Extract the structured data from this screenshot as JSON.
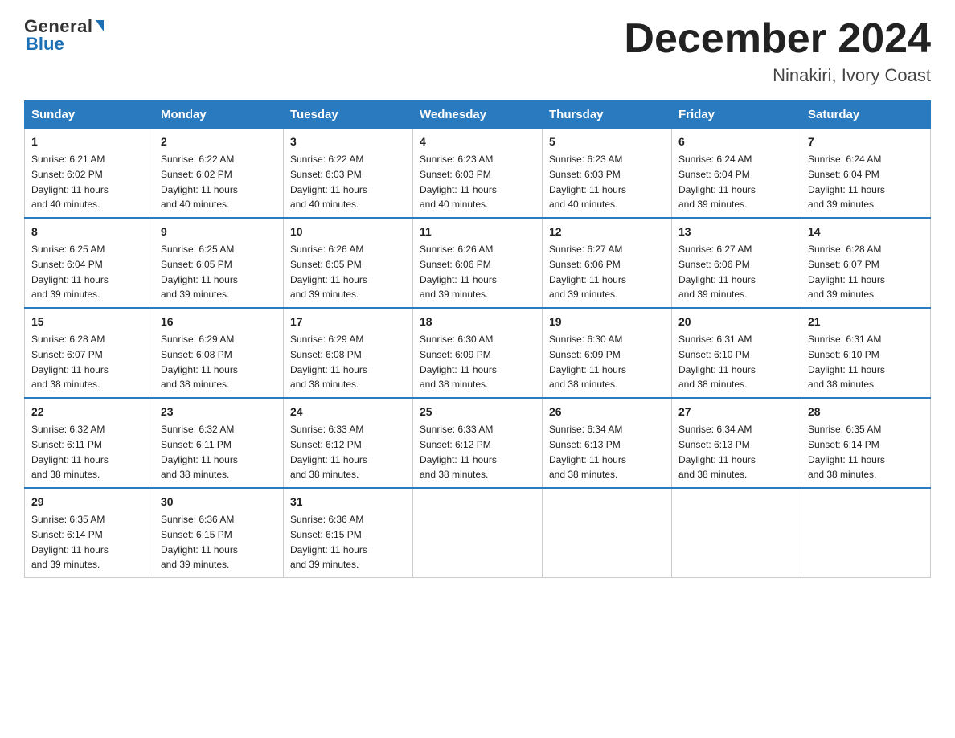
{
  "header": {
    "logo_general": "General",
    "logo_blue": "Blue",
    "month_title": "December 2024",
    "location": "Ninakiri, Ivory Coast"
  },
  "days_of_week": [
    "Sunday",
    "Monday",
    "Tuesday",
    "Wednesday",
    "Thursday",
    "Friday",
    "Saturday"
  ],
  "weeks": [
    [
      {
        "day": "1",
        "sunrise": "6:21 AM",
        "sunset": "6:02 PM",
        "daylight": "11 hours and 40 minutes."
      },
      {
        "day": "2",
        "sunrise": "6:22 AM",
        "sunset": "6:02 PM",
        "daylight": "11 hours and 40 minutes."
      },
      {
        "day": "3",
        "sunrise": "6:22 AM",
        "sunset": "6:03 PM",
        "daylight": "11 hours and 40 minutes."
      },
      {
        "day": "4",
        "sunrise": "6:23 AM",
        "sunset": "6:03 PM",
        "daylight": "11 hours and 40 minutes."
      },
      {
        "day": "5",
        "sunrise": "6:23 AM",
        "sunset": "6:03 PM",
        "daylight": "11 hours and 40 minutes."
      },
      {
        "day": "6",
        "sunrise": "6:24 AM",
        "sunset": "6:04 PM",
        "daylight": "11 hours and 39 minutes."
      },
      {
        "day": "7",
        "sunrise": "6:24 AM",
        "sunset": "6:04 PM",
        "daylight": "11 hours and 39 minutes."
      }
    ],
    [
      {
        "day": "8",
        "sunrise": "6:25 AM",
        "sunset": "6:04 PM",
        "daylight": "11 hours and 39 minutes."
      },
      {
        "day": "9",
        "sunrise": "6:25 AM",
        "sunset": "6:05 PM",
        "daylight": "11 hours and 39 minutes."
      },
      {
        "day": "10",
        "sunrise": "6:26 AM",
        "sunset": "6:05 PM",
        "daylight": "11 hours and 39 minutes."
      },
      {
        "day": "11",
        "sunrise": "6:26 AM",
        "sunset": "6:06 PM",
        "daylight": "11 hours and 39 minutes."
      },
      {
        "day": "12",
        "sunrise": "6:27 AM",
        "sunset": "6:06 PM",
        "daylight": "11 hours and 39 minutes."
      },
      {
        "day": "13",
        "sunrise": "6:27 AM",
        "sunset": "6:06 PM",
        "daylight": "11 hours and 39 minutes."
      },
      {
        "day": "14",
        "sunrise": "6:28 AM",
        "sunset": "6:07 PM",
        "daylight": "11 hours and 39 minutes."
      }
    ],
    [
      {
        "day": "15",
        "sunrise": "6:28 AM",
        "sunset": "6:07 PM",
        "daylight": "11 hours and 38 minutes."
      },
      {
        "day": "16",
        "sunrise": "6:29 AM",
        "sunset": "6:08 PM",
        "daylight": "11 hours and 38 minutes."
      },
      {
        "day": "17",
        "sunrise": "6:29 AM",
        "sunset": "6:08 PM",
        "daylight": "11 hours and 38 minutes."
      },
      {
        "day": "18",
        "sunrise": "6:30 AM",
        "sunset": "6:09 PM",
        "daylight": "11 hours and 38 minutes."
      },
      {
        "day": "19",
        "sunrise": "6:30 AM",
        "sunset": "6:09 PM",
        "daylight": "11 hours and 38 minutes."
      },
      {
        "day": "20",
        "sunrise": "6:31 AM",
        "sunset": "6:10 PM",
        "daylight": "11 hours and 38 minutes."
      },
      {
        "day": "21",
        "sunrise": "6:31 AM",
        "sunset": "6:10 PM",
        "daylight": "11 hours and 38 minutes."
      }
    ],
    [
      {
        "day": "22",
        "sunrise": "6:32 AM",
        "sunset": "6:11 PM",
        "daylight": "11 hours and 38 minutes."
      },
      {
        "day": "23",
        "sunrise": "6:32 AM",
        "sunset": "6:11 PM",
        "daylight": "11 hours and 38 minutes."
      },
      {
        "day": "24",
        "sunrise": "6:33 AM",
        "sunset": "6:12 PM",
        "daylight": "11 hours and 38 minutes."
      },
      {
        "day": "25",
        "sunrise": "6:33 AM",
        "sunset": "6:12 PM",
        "daylight": "11 hours and 38 minutes."
      },
      {
        "day": "26",
        "sunrise": "6:34 AM",
        "sunset": "6:13 PM",
        "daylight": "11 hours and 38 minutes."
      },
      {
        "day": "27",
        "sunrise": "6:34 AM",
        "sunset": "6:13 PM",
        "daylight": "11 hours and 38 minutes."
      },
      {
        "day": "28",
        "sunrise": "6:35 AM",
        "sunset": "6:14 PM",
        "daylight": "11 hours and 38 minutes."
      }
    ],
    [
      {
        "day": "29",
        "sunrise": "6:35 AM",
        "sunset": "6:14 PM",
        "daylight": "11 hours and 39 minutes."
      },
      {
        "day": "30",
        "sunrise": "6:36 AM",
        "sunset": "6:15 PM",
        "daylight": "11 hours and 39 minutes."
      },
      {
        "day": "31",
        "sunrise": "6:36 AM",
        "sunset": "6:15 PM",
        "daylight": "11 hours and 39 minutes."
      },
      null,
      null,
      null,
      null
    ]
  ],
  "labels": {
    "sunrise": "Sunrise:",
    "sunset": "Sunset:",
    "daylight": "Daylight:"
  }
}
